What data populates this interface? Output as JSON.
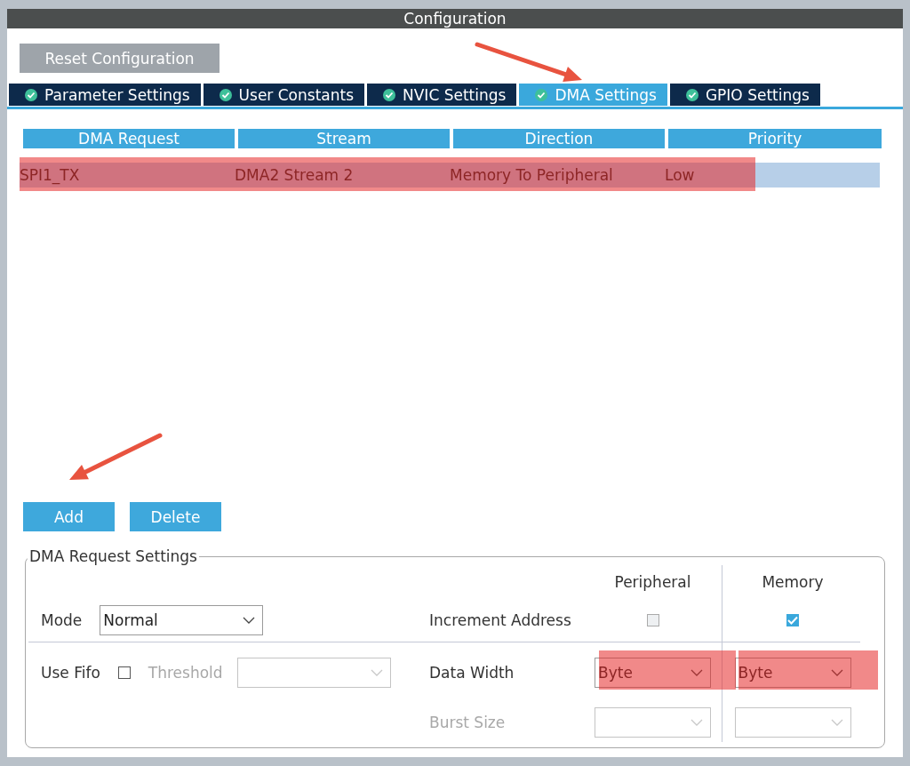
{
  "window": {
    "title": "Configuration"
  },
  "reset_button": "Reset Configuration",
  "tabs": [
    {
      "label": "Parameter Settings",
      "selected": false
    },
    {
      "label": "User Constants",
      "selected": false
    },
    {
      "label": "NVIC Settings",
      "selected": false
    },
    {
      "label": "DMA Settings",
      "selected": true
    },
    {
      "label": "GPIO Settings",
      "selected": false
    }
  ],
  "table": {
    "columns": [
      "DMA Request",
      "Stream",
      "Direction",
      "Priority"
    ],
    "rows": [
      {
        "cells": [
          "SPI1_TX",
          "DMA2 Stream 2",
          "Memory To Peripheral",
          "Low"
        ],
        "selected": true
      }
    ]
  },
  "buttons": [
    "Add",
    "Delete"
  ],
  "settings": {
    "title": "DMA Request Settings",
    "column_headers": [
      "Peripheral",
      "Memory"
    ],
    "mode": {
      "label": "Mode",
      "value": "Normal"
    },
    "increment_address": {
      "label": "Increment Address",
      "peripheral_checked": false,
      "memory_checked": true
    },
    "use_fifo": {
      "label": "Use Fifo",
      "checked": false
    },
    "threshold": {
      "label": "Threshold",
      "disabled": true
    },
    "data_width": {
      "label": "Data Width",
      "peripheral": "Byte",
      "memory": "Byte"
    },
    "burst_size": {
      "label": "Burst Size",
      "disabled": true
    }
  }
}
